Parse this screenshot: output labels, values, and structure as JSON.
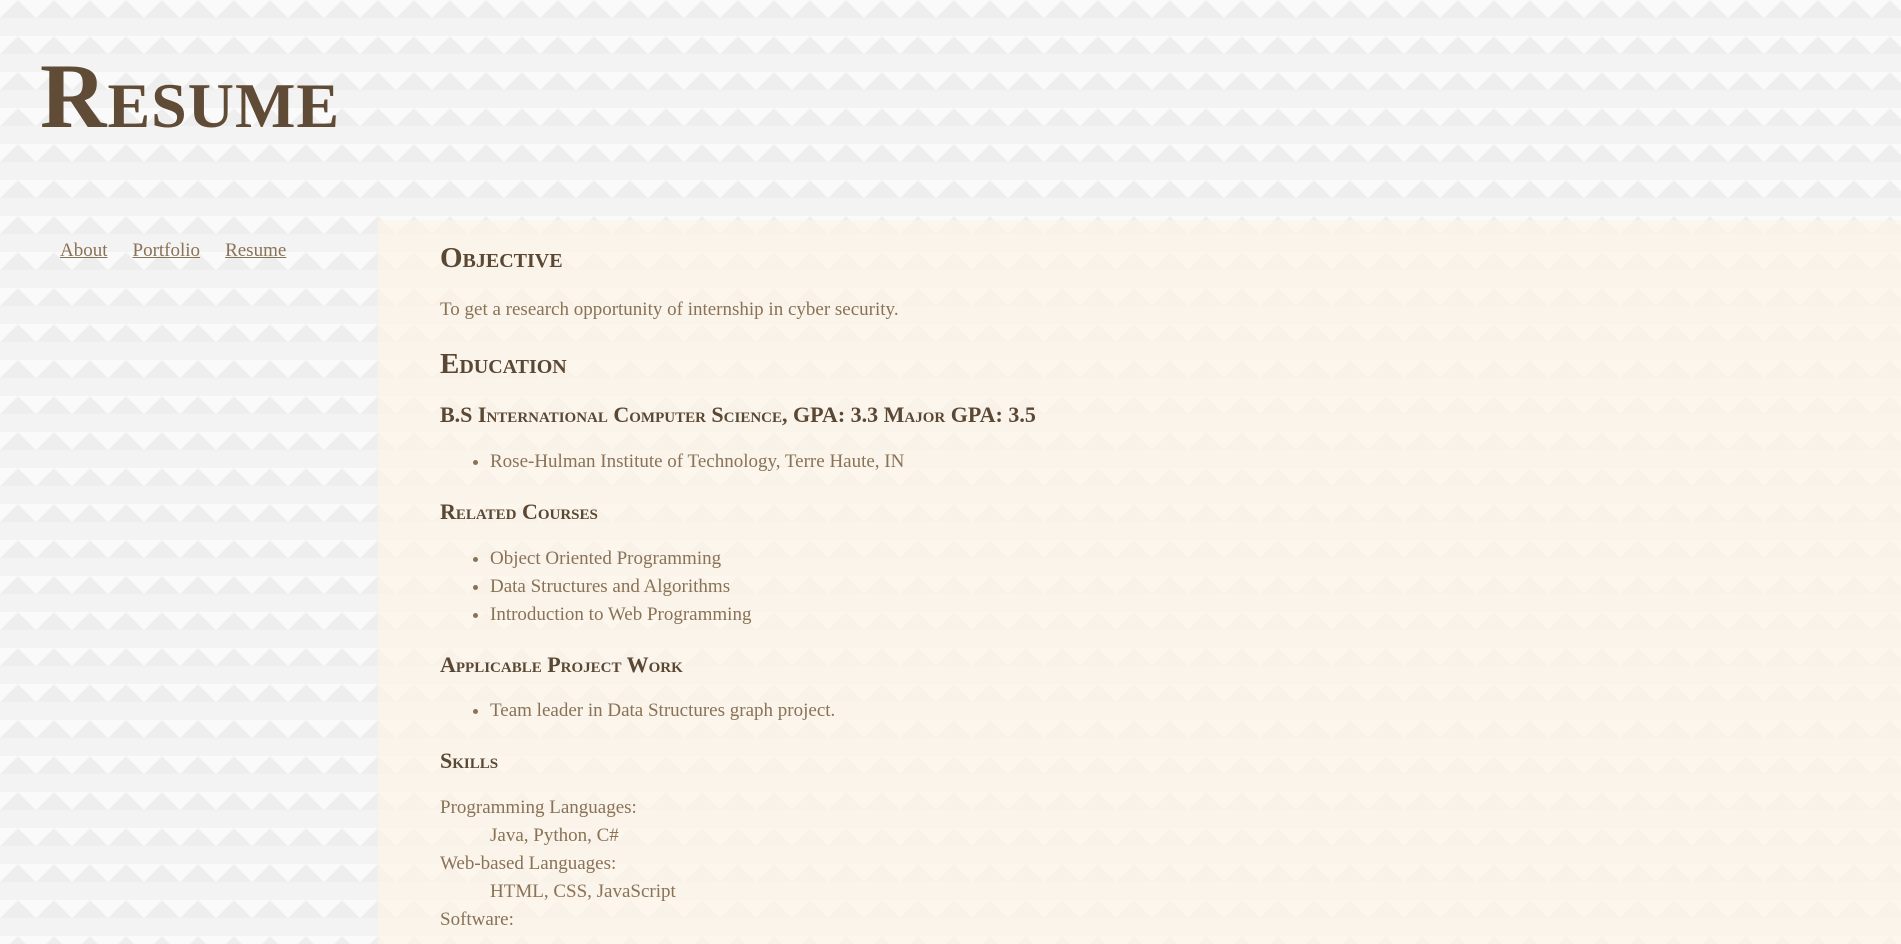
{
  "header": {
    "title": "Resume"
  },
  "nav": {
    "items": [
      "About",
      "Portfolio",
      "Resume"
    ]
  },
  "main": {
    "objective": {
      "heading": "Objective",
      "text": "To get a research opportunity of internship in cyber security."
    },
    "education": {
      "heading": "Education",
      "degree": "B.S International Computer Science, GPA: 3.3 Major GPA: 3.5",
      "institutions": [
        "Rose-Hulman Institute of Technology, Terre Haute, IN"
      ]
    },
    "related_courses": {
      "heading": "Related Courses",
      "items": [
        "Object Oriented Programming",
        "Data Structures and Algorithms",
        "Introduction to Web Programming"
      ]
    },
    "project_work": {
      "heading": "Applicable Project Work",
      "items": [
        "Team leader in Data Structures graph project."
      ]
    },
    "skills": {
      "heading": "Skills",
      "groups": [
        {
          "label": "Programming Languages:",
          "value": "Java, Python, C#"
        },
        {
          "label": "Web-based Languages:",
          "value": "HTML, CSS, JavaScript"
        },
        {
          "label": "Software:",
          "value": ""
        }
      ]
    }
  },
  "colors": {
    "heading": "#5a4734",
    "title": "#5f4b36",
    "body_text": "#8a7256",
    "content_bg": "#fcf4e6",
    "page_bg": "#f3f3f3"
  }
}
